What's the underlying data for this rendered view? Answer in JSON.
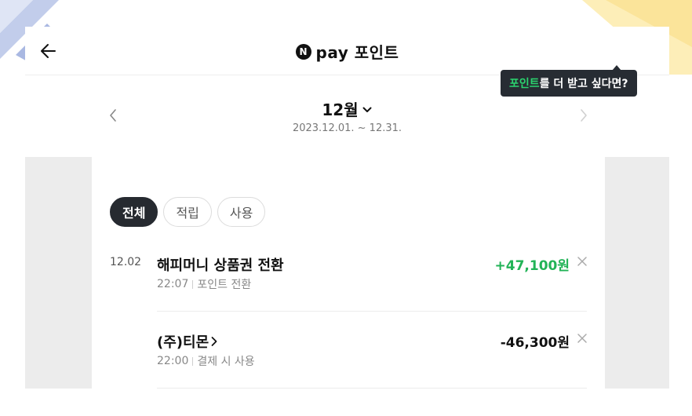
{
  "header": {
    "title": "pay 포인트",
    "logo_letter": "N"
  },
  "tooltip": {
    "highlight": "포인트",
    "text": "를 더 받고 싶다면?"
  },
  "month_nav": {
    "month_label": "12월",
    "date_range": "2023.12.01. ~ 12.31."
  },
  "filters": [
    {
      "label": "전체",
      "active": true
    },
    {
      "label": "적립",
      "active": false
    },
    {
      "label": "사용",
      "active": false
    }
  ],
  "transactions": [
    {
      "date": "12.02",
      "title": "해피머니 상품권 전환",
      "time": "22:07",
      "category": "포인트 전환",
      "amount": "+47,100원",
      "type": "plus"
    },
    {
      "date": "",
      "title": "(주)티몬",
      "time": "22:00",
      "category": "결제 시 사용",
      "amount": "-46,300원",
      "type": "minus"
    }
  ],
  "colors": {
    "accent_green": "#22b357",
    "tooltip_bg": "#272c33",
    "tooltip_highlight": "#2bd46f"
  }
}
